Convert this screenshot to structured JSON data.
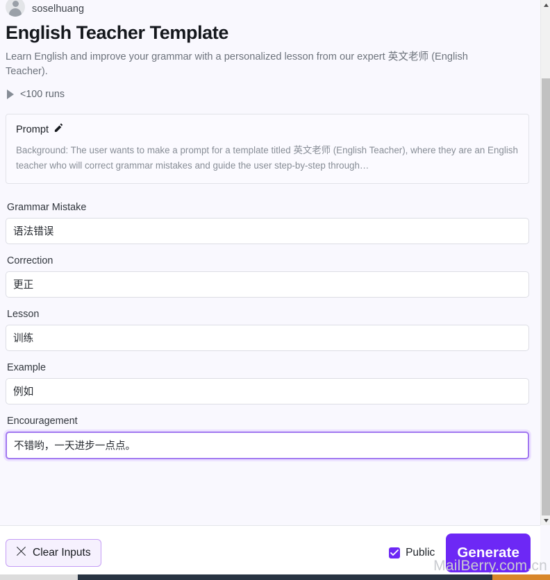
{
  "author": {
    "name": "soselhuang",
    "avatar_icon": "user-avatar-icon"
  },
  "header": {
    "title": "English Teacher Template",
    "description": "Learn English and improve your grammar with a personalized lesson from our expert 英文老师 (English Teacher).",
    "runs_label": "<100 runs",
    "runs_icon": "play-triangle-icon"
  },
  "prompt_card": {
    "title": "Prompt",
    "edit_icon": "edit-pencil-icon",
    "body": "Background: The user wants to make a prompt for a template titled 英文老师 (English Teacher), where they are an English teacher who will correct grammar mistakes and guide the user step-by-step through…"
  },
  "fields": [
    {
      "label": "Grammar Mistake",
      "value": "语法错误",
      "placeholder": "Grammar Mistake",
      "focused": false
    },
    {
      "label": "Correction",
      "value": "更正",
      "placeholder": "Correction",
      "focused": false
    },
    {
      "label": "Lesson",
      "value": "训练",
      "placeholder": "Lesson",
      "focused": false
    },
    {
      "label": "Example",
      "value": "例如",
      "placeholder": "Example",
      "focused": false
    },
    {
      "label": "Encouragement",
      "value": "不错哟，一天进步一点点。",
      "placeholder": "Encouragement",
      "focused": true
    }
  ],
  "footer": {
    "clear_label": "Clear Inputs",
    "clear_icon": "close-x-icon",
    "public_label": "Public",
    "public_checked": true,
    "check_icon": "checkmark-icon",
    "generate_label": "Generate"
  },
  "watermark": {
    "text": "MailBerry.com.cn"
  },
  "colors": {
    "accent": "#6d28f5",
    "focus_border": "#a177f0",
    "focus_glow": "#ece2ff",
    "page_bg": "#f9f8fe",
    "muted_text": "#6d737c",
    "scrollbar_thumb": "#c1c1c1",
    "hscroll_track": "#283442",
    "hscroll_accent": "#d8862a"
  }
}
